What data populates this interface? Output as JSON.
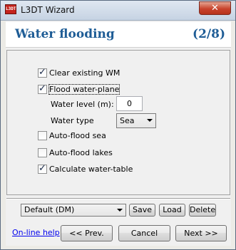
{
  "window": {
    "title": "L3DT Wizard",
    "app_icon_text": "L3DT",
    "close_glyph": "✕"
  },
  "header": {
    "title": "Water flooding",
    "step": "(2/8)"
  },
  "options": {
    "clear_existing_wm": {
      "label": "Clear existing WM",
      "checked": true
    },
    "flood_water_plane": {
      "label": "Flood water-plane",
      "checked": true
    },
    "water_level_label": "Water level (m):",
    "water_level_value": "0",
    "water_type_label": "Water type",
    "water_type_value": "Sea",
    "auto_flood_sea": {
      "label": "Auto-flood sea",
      "checked": false
    },
    "auto_flood_lakes": {
      "label": "Auto-flood lakes",
      "checked": false
    },
    "calculate_water_table": {
      "label": "Calculate water-table",
      "checked": true
    }
  },
  "preset": {
    "selected": "Default (DM)",
    "save_label": "Save",
    "load_label": "Load",
    "delete_label": "Delete"
  },
  "footer": {
    "help_link": "On-line help",
    "prev_label": "<< Prev.",
    "cancel_label": "Cancel",
    "next_label": "Next >>"
  }
}
